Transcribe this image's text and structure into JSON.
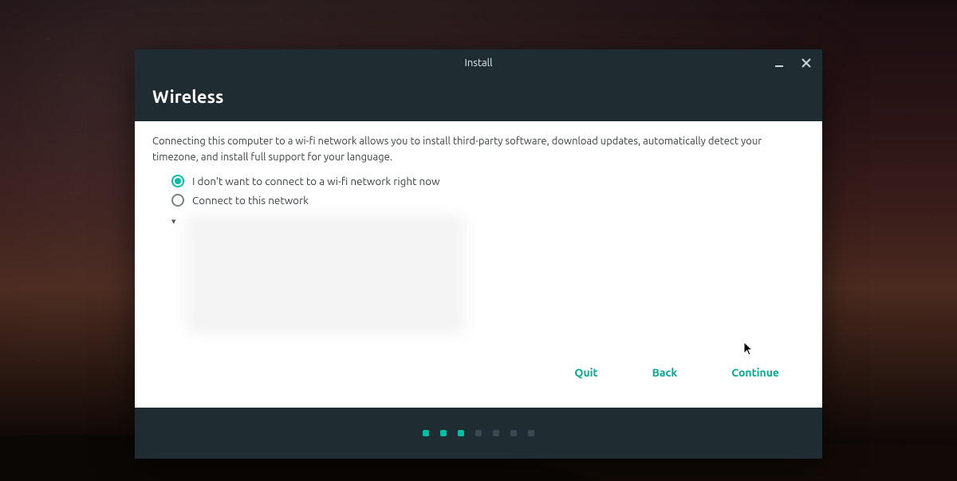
{
  "window": {
    "title": "Install"
  },
  "page": {
    "heading": "Wireless",
    "description": "Connecting this computer to a wi-fi network allows you to install third-party software, download updates, automatically detect your timezone, and install full support for your language."
  },
  "options": {
    "no_connect": {
      "label": "I don't want to connect to a wi-fi network right now",
      "selected": true
    },
    "connect": {
      "label": "Connect to this network",
      "selected": false
    }
  },
  "buttons": {
    "quit": "Quit",
    "back": "Back",
    "continue": "Continue"
  },
  "progress": {
    "total": 7,
    "active_count": 3
  },
  "colors": {
    "accent": "#00bfa5",
    "header_bg": "#1f2d33"
  }
}
